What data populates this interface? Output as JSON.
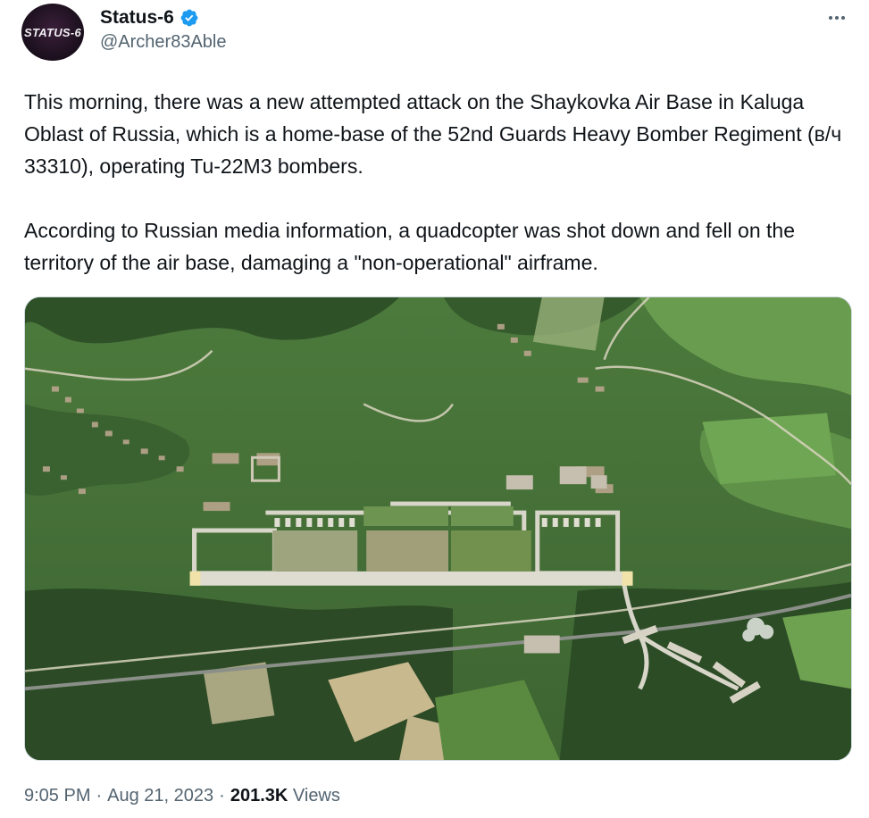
{
  "author": {
    "avatar_text": "STATUS-6",
    "display_name": "Status-6",
    "handle": "@Archer83Able",
    "verified": true
  },
  "tweet": {
    "paragraphs": [
      "This morning, there was a new attempted attack on the Shaykovka Air Base in Kaluga Oblast of Russia, which is a home-base of the 52nd Guards Heavy Bomber Regiment (в/ч 33310), operating Tu-22M3 bombers.",
      "According to Russian media information, a quadcopter was shot down and fell on the territory of the air base, damaging a \"non-operational\" airframe."
    ],
    "time": "9:05 PM",
    "date": "Aug 21, 2023",
    "views_count": "201.3K",
    "views_label": "Views",
    "separator": "·"
  },
  "icons": {
    "more": "more-options-icon",
    "verified": "verified-badge-icon"
  },
  "colors": {
    "text_primary": "#0f1419",
    "text_secondary": "#536471",
    "verified_blue": "#1d9bf0"
  }
}
